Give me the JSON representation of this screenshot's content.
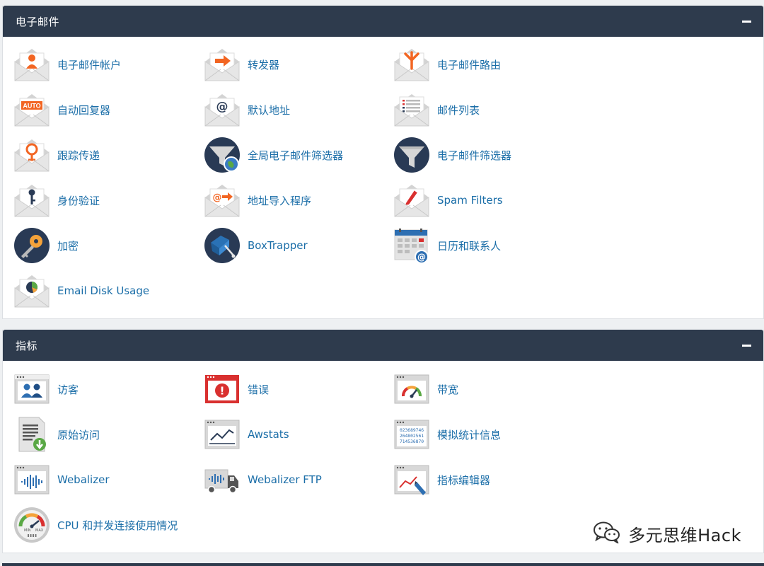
{
  "email_section": {
    "title": "电子邮件",
    "items": [
      {
        "label": "电子邮件帐户",
        "icon": "envelope-user-icon"
      },
      {
        "label": "转发器",
        "icon": "envelope-forward-icon"
      },
      {
        "label": "电子邮件路由",
        "icon": "envelope-routing-icon"
      },
      {
        "label": "自动回复器",
        "icon": "envelope-auto-icon",
        "badge": "AUTO"
      },
      {
        "label": "默认地址",
        "icon": "envelope-at-icon",
        "badge": "@"
      },
      {
        "label": "邮件列表",
        "icon": "envelope-list-icon"
      },
      {
        "label": "跟踪传递",
        "icon": "envelope-track-icon"
      },
      {
        "label": "全局电子邮件筛选器",
        "icon": "global-filter-icon"
      },
      {
        "label": "电子邮件筛选器",
        "icon": "filter-icon"
      },
      {
        "label": "身份验证",
        "icon": "envelope-key-icon"
      },
      {
        "label": "地址导入程序",
        "icon": "envelope-import-icon",
        "badge": "@"
      },
      {
        "label": "Spam Filters",
        "icon": "envelope-spam-icon"
      },
      {
        "label": "加密",
        "icon": "encryption-key-icon"
      },
      {
        "label": "BoxTrapper",
        "icon": "boxtrapper-icon"
      },
      {
        "label": "日历和联系人",
        "icon": "calendar-contacts-icon",
        "badge": "@"
      },
      {
        "label": "Email Disk Usage",
        "icon": "envelope-disk-usage-icon"
      }
    ]
  },
  "metrics_section": {
    "title": "指标",
    "items": [
      {
        "label": "访客",
        "icon": "visitors-icon"
      },
      {
        "label": "错误",
        "icon": "errors-icon",
        "badge": "!"
      },
      {
        "label": "带宽",
        "icon": "bandwidth-icon"
      },
      {
        "label": "原始访问",
        "icon": "raw-access-icon"
      },
      {
        "label": "Awstats",
        "icon": "awstats-icon"
      },
      {
        "label": "模拟统计信息",
        "icon": "analog-stats-icon",
        "digits": [
          "023689746",
          "264802561",
          "714536870"
        ]
      },
      {
        "label": "Webalizer",
        "icon": "webalizer-icon"
      },
      {
        "label": "Webalizer FTP",
        "icon": "webalizer-ftp-icon"
      },
      {
        "label": "指标编辑器",
        "icon": "metrics-editor-icon"
      },
      {
        "label": "CPU 和并发连接使用情况",
        "icon": "cpu-usage-icon",
        "gauge_labels": [
          "MIN",
          "MAX"
        ]
      }
    ]
  },
  "watermark": {
    "text": "多元思维Hack",
    "icon": "wechat-icon"
  },
  "colors": {
    "header": "#2e3b4d",
    "link": "#1b6ea8",
    "accent": "#f26522",
    "navy": "#293a55",
    "red": "#d9302f"
  }
}
